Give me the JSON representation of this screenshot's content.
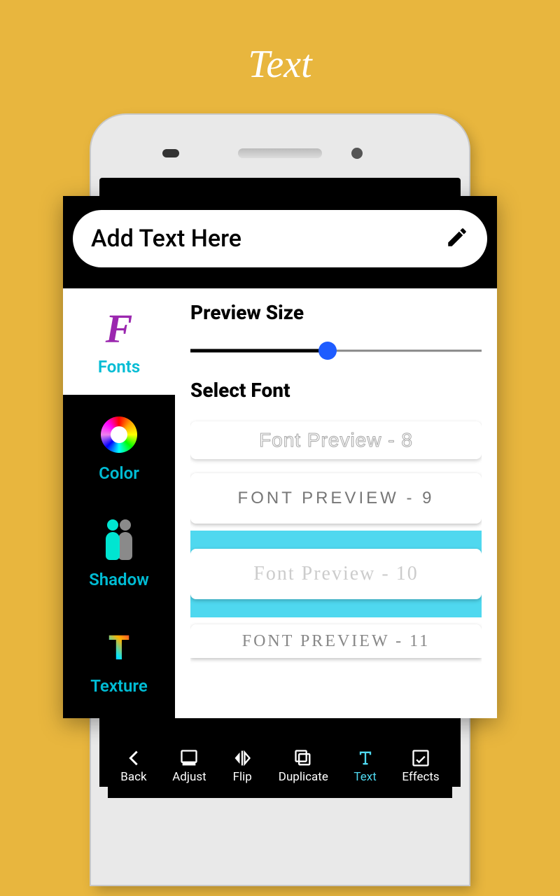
{
  "page_title": "Text",
  "textbar": {
    "placeholder": "Add Text Here"
  },
  "sidebar": {
    "items": [
      {
        "label": "Fonts"
      },
      {
        "label": "Color"
      },
      {
        "label": "Shadow"
      },
      {
        "label": "Texture"
      }
    ]
  },
  "main": {
    "preview_size_label": "Preview Size",
    "select_font_label": "Select Font",
    "slider_value_pct": 47,
    "fonts": [
      {
        "label": "Font Preview - 8"
      },
      {
        "label": "FONT PREVIEW - 9"
      },
      {
        "label": "Font Preview - 10"
      },
      {
        "label": "FONT PREVIEW - 11"
      }
    ],
    "selected_font_index": 2
  },
  "bottombar": {
    "items": [
      {
        "label": "Back"
      },
      {
        "label": "Adjust"
      },
      {
        "label": "Flip"
      },
      {
        "label": "Duplicate"
      },
      {
        "label": "Text"
      },
      {
        "label": "Effects"
      }
    ],
    "active_index": 4
  }
}
